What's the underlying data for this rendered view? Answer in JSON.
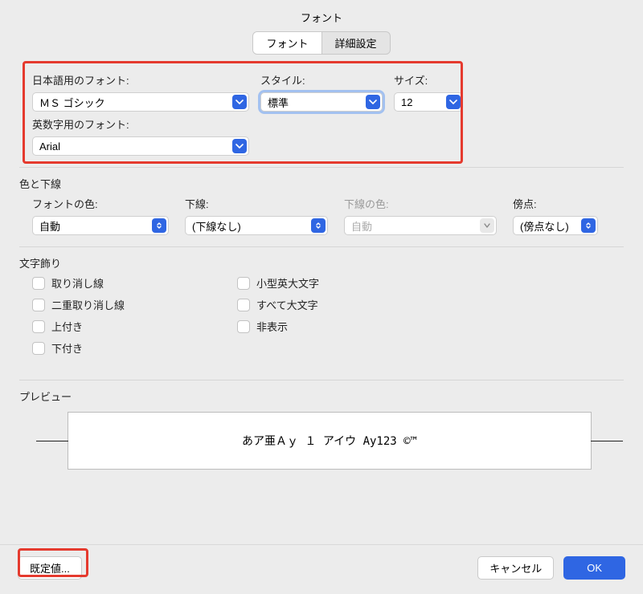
{
  "title": "フォント",
  "tabs": {
    "font": "フォント",
    "advanced": "詳細設定"
  },
  "fontSection": {
    "jpFontLabel": "日本語用のフォント:",
    "styleLabel": "スタイル:",
    "sizeLabel": "サイズ:",
    "jpFontValue": "ＭＳ ゴシック",
    "styleValue": "標準",
    "sizeValue": "12",
    "latinFontLabel": "英数字用のフォント:",
    "latinFontValue": "Arial"
  },
  "colorSection": {
    "heading": "色と下線",
    "fontColorLabel": "フォントの色:",
    "underlineLabel": "下線:",
    "underlineColorLabel": "下線の色:",
    "emphasisLabel": "傍点:",
    "fontColorValue": "自動",
    "underlineValue": "(下線なし)",
    "underlineColorValue": "自動",
    "emphasisValue": "(傍点なし)"
  },
  "effects": {
    "heading": "文字飾り",
    "strike": "取り消し線",
    "dstrike": "二重取り消し線",
    "superscript": "上付き",
    "subscript": "下付き",
    "smallcaps": "小型英大文字",
    "allcaps": "すべて大文字",
    "hidden": "非表示"
  },
  "preview": {
    "heading": "プレビュー",
    "sample": "あア亜Ａｙ １ アイウ Ay123 ©™"
  },
  "footer": {
    "defaults": "既定値...",
    "cancel": "キャンセル",
    "ok": "OK"
  }
}
